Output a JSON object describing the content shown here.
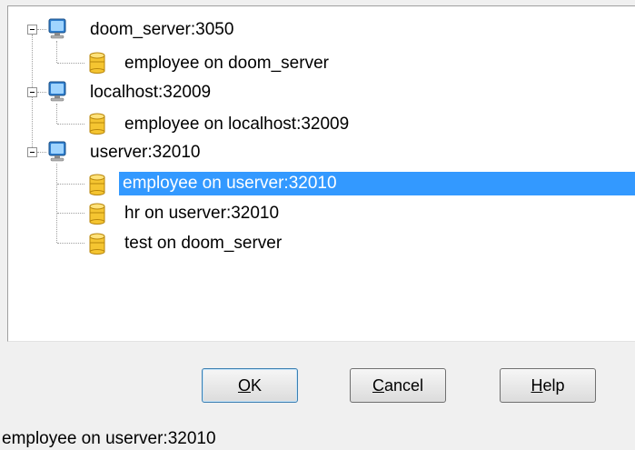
{
  "tree": {
    "servers": [
      {
        "label": "doom_server:3050",
        "icon": "computer-icon",
        "expanded": true,
        "databases": [
          {
            "label": "employee on doom_server",
            "icon": "database-icon",
            "selected": false
          }
        ]
      },
      {
        "label": "localhost:32009",
        "icon": "computer-icon",
        "expanded": true,
        "databases": [
          {
            "label": "employee on localhost:32009",
            "icon": "database-icon",
            "selected": false
          }
        ]
      },
      {
        "label": "userver:32010",
        "icon": "computer-icon",
        "expanded": true,
        "databases": [
          {
            "label": "employee on userver:32010",
            "icon": "database-icon",
            "selected": true
          },
          {
            "label": "hr on userver:32010",
            "icon": "database-icon",
            "selected": false
          },
          {
            "label": "test on doom_server",
            "icon": "database-icon",
            "selected": false
          }
        ]
      }
    ]
  },
  "buttons": {
    "ok": {
      "mnemonic": "O",
      "rest": "K"
    },
    "cancel": {
      "mnemonic": "C",
      "rest": "ancel"
    },
    "help": {
      "mnemonic": "H",
      "rest": "elp"
    }
  },
  "status": {
    "text": "employee on userver:32010"
  },
  "colors": {
    "selection": "#3399ff",
    "selection_text": "#ffffff",
    "database_icon": "#f5c531",
    "computer_icon": "#4a9fe0"
  }
}
